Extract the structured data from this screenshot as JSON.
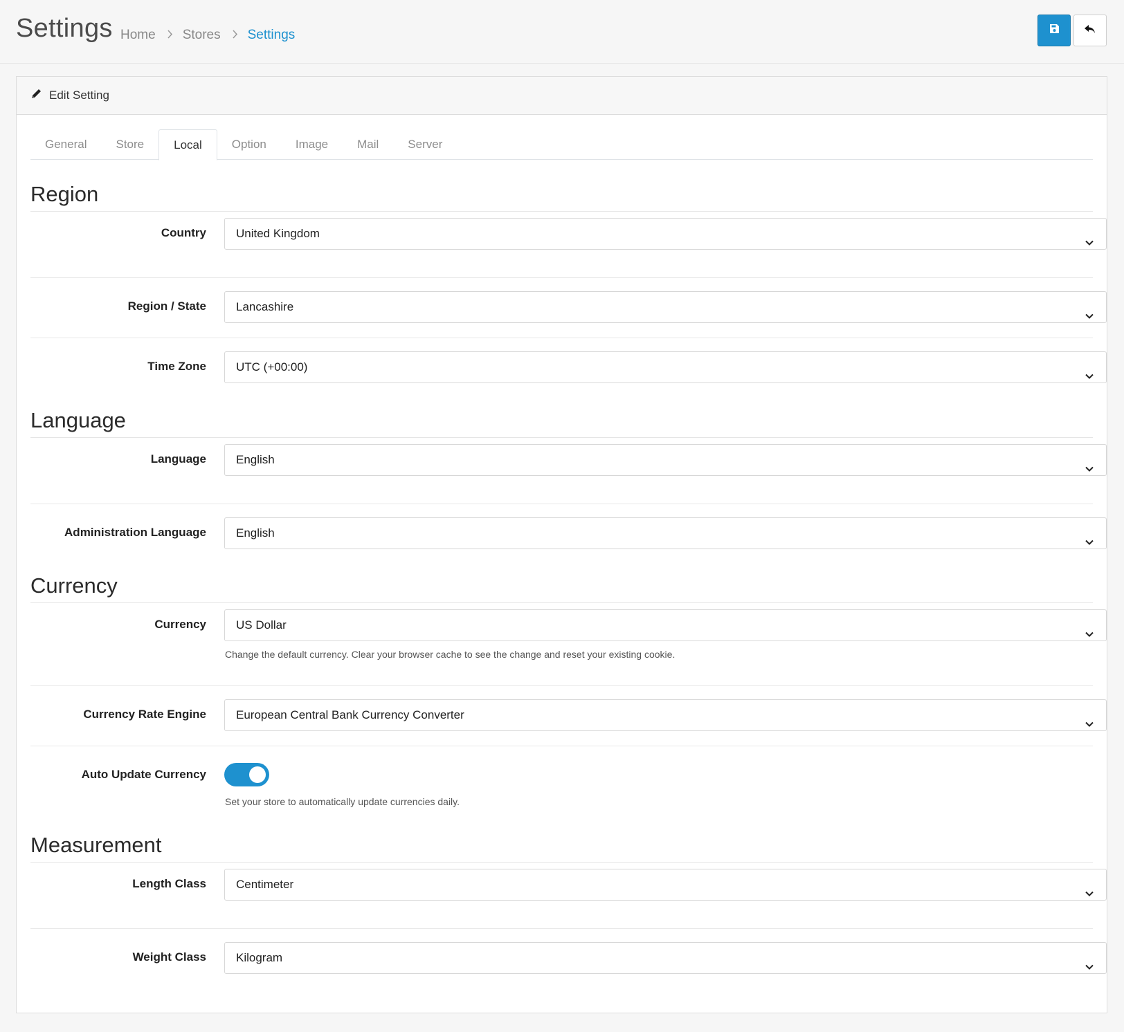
{
  "header": {
    "title": "Settings",
    "breadcrumb": [
      "Home",
      "Stores",
      "Settings"
    ]
  },
  "card": {
    "title": "Edit Setting"
  },
  "tabs": [
    "General",
    "Store",
    "Local",
    "Option",
    "Image",
    "Mail",
    "Server"
  ],
  "active_tab": "Local",
  "sections": {
    "region": {
      "legend": "Region",
      "country": {
        "label": "Country",
        "value": "United Kingdom"
      },
      "zone": {
        "label": "Region / State",
        "value": "Lancashire"
      },
      "timezone": {
        "label": "Time Zone",
        "value": "UTC (+00:00)"
      }
    },
    "language": {
      "legend": "Language",
      "language": {
        "label": "Language",
        "value": "English"
      },
      "admin_language": {
        "label": "Administration Language",
        "value": "English"
      }
    },
    "currency": {
      "legend": "Currency",
      "currency": {
        "label": "Currency",
        "value": "US Dollar",
        "help": "Change the default currency. Clear your browser cache to see the change and reset your existing cookie."
      },
      "engine": {
        "label": "Currency Rate Engine",
        "value": "European Central Bank Currency Converter"
      },
      "auto_update": {
        "label": "Auto Update Currency",
        "enabled": true,
        "help": "Set your store to automatically update currencies daily."
      }
    },
    "measurement": {
      "legend": "Measurement",
      "length": {
        "label": "Length Class",
        "value": "Centimeter"
      },
      "weight": {
        "label": "Weight Class",
        "value": "Kilogram"
      }
    }
  },
  "colors": {
    "primary": "#1e91cf",
    "background": "#f6f6f6"
  },
  "icons": {
    "save": "floppy-disk-icon",
    "back": "reply-icon",
    "edit": "pencil-icon",
    "select": "chevron-down-icon",
    "breadcrumb_separator": "chevron-right-icon"
  }
}
